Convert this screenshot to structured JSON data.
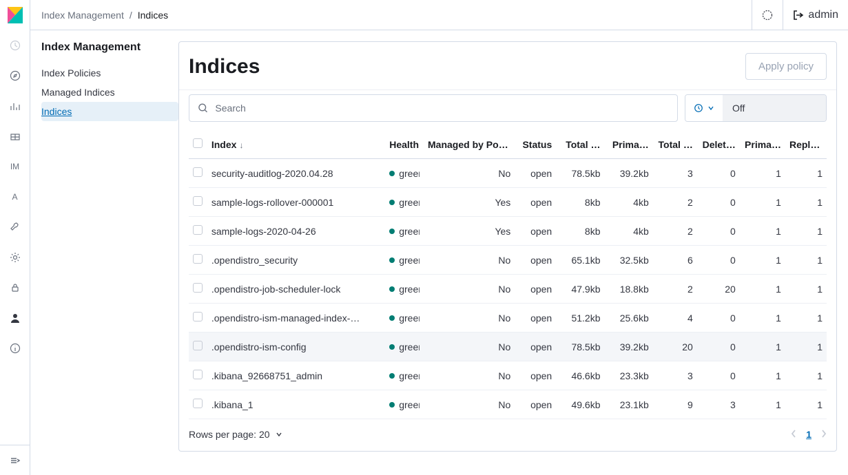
{
  "breadcrumb": {
    "parent": "Index Management",
    "current": "Indices"
  },
  "user": "admin",
  "sidenav": {
    "title": "Index Management",
    "items": [
      {
        "label": "Index Policies",
        "active": false
      },
      {
        "label": "Managed Indices",
        "active": false
      },
      {
        "label": "Indices",
        "active": true
      }
    ]
  },
  "page": {
    "title": "Indices",
    "apply_policy_label": "Apply policy",
    "search_placeholder": "Search",
    "autorefresh_label": "Off"
  },
  "table": {
    "columns": {
      "index": "Index",
      "health": "Health",
      "managed": "Managed by Policy",
      "status": "Status",
      "total_size": "Total …",
      "prim_size": "Prima…",
      "total_docs": "Total …",
      "deleted": "Delet…",
      "prim_shards": "Prima…",
      "replicas": "Replic…"
    },
    "sort_column": "index",
    "rows": [
      {
        "index": "security-auditlog-2020.04.28",
        "health": "green",
        "managed": "No",
        "status": "open",
        "total_size": "78.5kb",
        "prim_size": "39.2kb",
        "total_docs": "3",
        "deleted": "0",
        "prim_shards": "1",
        "replicas": "1"
      },
      {
        "index": "sample-logs-rollover-000001",
        "health": "green",
        "managed": "Yes",
        "status": "open",
        "total_size": "8kb",
        "prim_size": "4kb",
        "total_docs": "2",
        "deleted": "0",
        "prim_shards": "1",
        "replicas": "1"
      },
      {
        "index": "sample-logs-2020-04-26",
        "health": "green",
        "managed": "Yes",
        "status": "open",
        "total_size": "8kb",
        "prim_size": "4kb",
        "total_docs": "2",
        "deleted": "0",
        "prim_shards": "1",
        "replicas": "1"
      },
      {
        "index": ".opendistro_security",
        "health": "green",
        "managed": "No",
        "status": "open",
        "total_size": "65.1kb",
        "prim_size": "32.5kb",
        "total_docs": "6",
        "deleted": "0",
        "prim_shards": "1",
        "replicas": "1"
      },
      {
        "index": ".opendistro-job-scheduler-lock",
        "health": "green",
        "managed": "No",
        "status": "open",
        "total_size": "47.9kb",
        "prim_size": "18.8kb",
        "total_docs": "2",
        "deleted": "20",
        "prim_shards": "1",
        "replicas": "1"
      },
      {
        "index": ".opendistro-ism-managed-index-…",
        "health": "green",
        "managed": "No",
        "status": "open",
        "total_size": "51.2kb",
        "prim_size": "25.6kb",
        "total_docs": "4",
        "deleted": "0",
        "prim_shards": "1",
        "replicas": "1"
      },
      {
        "index": ".opendistro-ism-config",
        "health": "green",
        "managed": "No",
        "status": "open",
        "total_size": "78.5kb",
        "prim_size": "39.2kb",
        "total_docs": "20",
        "deleted": "0",
        "prim_shards": "1",
        "replicas": "1",
        "selected": true
      },
      {
        "index": ".kibana_92668751_admin",
        "health": "green",
        "managed": "No",
        "status": "open",
        "total_size": "46.6kb",
        "prim_size": "23.3kb",
        "total_docs": "3",
        "deleted": "0",
        "prim_shards": "1",
        "replicas": "1"
      },
      {
        "index": ".kibana_1",
        "health": "green",
        "managed": "No",
        "status": "open",
        "total_size": "49.6kb",
        "prim_size": "23.1kb",
        "total_docs": "9",
        "deleted": "3",
        "prim_shards": "1",
        "replicas": "1"
      }
    ],
    "rows_per_page_label": "Rows per page: 20",
    "current_page": "1"
  }
}
